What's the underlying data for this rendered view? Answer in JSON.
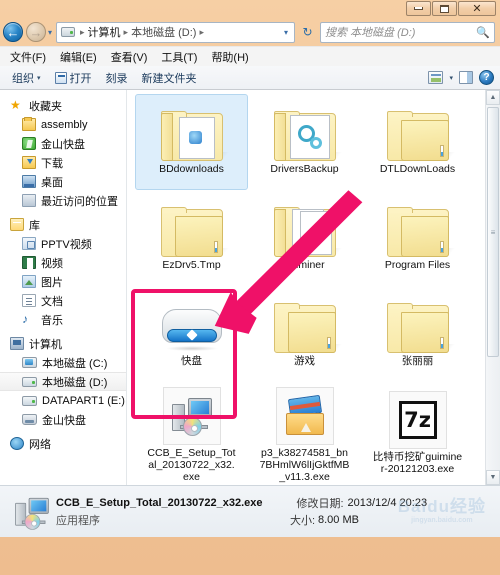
{
  "window": {
    "controls": {
      "minimize": "minimize",
      "maximize": "maximize",
      "close": "close"
    }
  },
  "address": {
    "back_icon": "back-arrow-icon",
    "forward_icon": "forward-arrow-icon",
    "history_caret": "▾",
    "drive_icon": "drive-icon",
    "crumbs": [
      "计算机",
      "本地磁盘 (D:)"
    ],
    "separator": "▸",
    "caret": "▾",
    "refresh_icon": "↻"
  },
  "search": {
    "placeholder": "搜索 本地磁盘 (D:)",
    "icon": "search-icon"
  },
  "menu": {
    "items": [
      "文件(F)",
      "编辑(E)",
      "查看(V)",
      "工具(T)",
      "帮助(H)"
    ]
  },
  "toolbar": {
    "organize": "组织",
    "organize_caret": "▾",
    "open": "打开",
    "burn": "刻录",
    "new_folder": "新建文件夹",
    "view_caret": "▾",
    "help": "?"
  },
  "sidebar": {
    "groups": [
      {
        "root": {
          "label": "收藏夹",
          "icon": "star-icon"
        },
        "items": [
          {
            "label": "assembly",
            "icon": "folder-icon"
          },
          {
            "label": "金山快盘",
            "icon": "kingsoft-icon"
          },
          {
            "label": "下载",
            "icon": "downloads-icon"
          },
          {
            "label": "桌面",
            "icon": "desktop-icon"
          },
          {
            "label": "最近访问的位置",
            "icon": "recent-places-icon"
          }
        ]
      },
      {
        "root": {
          "label": "库",
          "icon": "library-icon"
        },
        "items": [
          {
            "label": "PPTV视频",
            "icon": "pptv-icon"
          },
          {
            "label": "视频",
            "icon": "video-icon"
          },
          {
            "label": "图片",
            "icon": "pictures-icon"
          },
          {
            "label": "文档",
            "icon": "documents-icon"
          },
          {
            "label": "音乐",
            "icon": "music-icon"
          }
        ]
      },
      {
        "root": {
          "label": "计算机",
          "icon": "computer-icon"
        },
        "items": [
          {
            "label": "本地磁盘 (C:)",
            "icon": "system-drive-icon",
            "selected": false
          },
          {
            "label": "本地磁盘 (D:)",
            "icon": "drive-icon",
            "selected": true
          },
          {
            "label": "DATAPART1 (E:)",
            "icon": "drive-icon",
            "selected": false
          },
          {
            "label": "金山快盘",
            "icon": "kuaipan-drive-icon",
            "selected": false
          }
        ]
      },
      {
        "root": {
          "label": "网络",
          "icon": "network-icon"
        },
        "items": []
      }
    ]
  },
  "files": {
    "items": [
      {
        "name": "BDdownloads",
        "type": "folder",
        "variant": "baidu",
        "selected": true
      },
      {
        "name": "DriversBackup",
        "type": "folder",
        "variant": "gears",
        "selected": false
      },
      {
        "name": "DTLDownLoads",
        "type": "folder",
        "variant": "plain",
        "selected": false
      },
      {
        "name": "EzDrv5.Tmp",
        "type": "folder",
        "variant": "plain",
        "selected": false
      },
      {
        "name": "guiminer",
        "type": "folder",
        "variant": "docs",
        "selected": false
      },
      {
        "name": "Program Files",
        "type": "folder",
        "variant": "plain",
        "selected": false
      },
      {
        "name": "快盘",
        "type": "drive",
        "variant": "kuaipan",
        "selected": false
      },
      {
        "name": "游戏",
        "type": "folder",
        "variant": "plain",
        "selected": false
      },
      {
        "name": "张丽丽",
        "type": "folder",
        "variant": "plain",
        "selected": false
      },
      {
        "name": "CCB_E_Setup_Total_20130722_x32.exe",
        "type": "exe",
        "variant": "installer",
        "selected": false
      },
      {
        "name": "p3_k38274581_bn7BHmlW6lIjGktfMB_v11.3.exe",
        "type": "exe",
        "variant": "package",
        "selected": false
      },
      {
        "name": "比特币挖矿guiminer-20121203.exe",
        "type": "exe",
        "variant": "sevenzip",
        "selected": false
      }
    ]
  },
  "annotation": {
    "color": "#ef1168",
    "arrow": "pink-arrow",
    "highlight_target": "CCB_E_Setup_Total_20130722_x32.exe"
  },
  "scrollbar": {
    "up": "▲",
    "down": "▼",
    "grip": "≡"
  },
  "status": {
    "icon": "installer-icon",
    "file_name": "CCB_E_Setup_Total_20130722_x32.exe",
    "modified_label": "修改日期:",
    "modified_value": "2013/12/4 20:23",
    "kind": "应用程序",
    "size_label": "大小:",
    "size_value": "8.00 MB"
  },
  "watermark": {
    "main": "Baidu经验",
    "sub": "jingyan.baidu.com"
  }
}
